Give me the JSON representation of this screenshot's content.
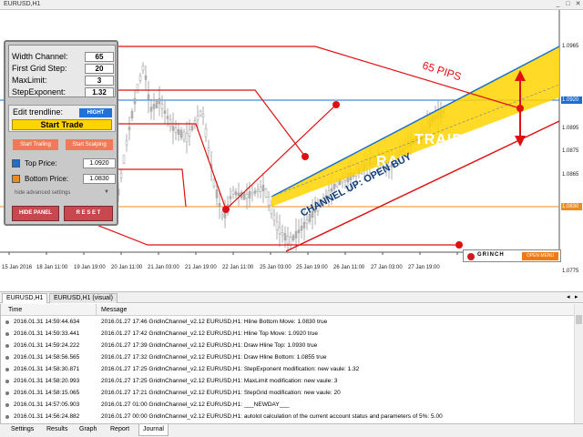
{
  "window": {
    "title": "EURUSD,H1"
  },
  "panel": {
    "width_channel_label": "Width Channel:",
    "width_channel_value": "65",
    "first_grid_label": "First Grid Step:",
    "first_grid_value": "20",
    "maxlimit_label": "MaxLimit:",
    "maxlimit_value": "3",
    "stepexponent_label": "StepExponent:",
    "stepexponent_value": "1.32",
    "edit_trendline_label": "Edit trendline:",
    "hight_button": "HIGHT",
    "start_trade": "Start Trade",
    "start_trailing": "Start Trailing",
    "start_scalping": "Start Scalping",
    "top_price_label": "Top Price:",
    "top_price_value": "1.0920",
    "bottom_price_label": "Bottom Price:",
    "bottom_price_value": "1.0830",
    "hide_advanced": "hide advanced settings",
    "hide_panel": "HIDE PANEL",
    "reset": "R E S E T"
  },
  "annotations": {
    "pips": "65 PIPS",
    "traiding": "TRAIDING",
    "range": "RANGE",
    "channel": "CHANNEL UP: OPEN BUY",
    "grinch": "GRINCH",
    "open_menu": "OPEN MENU"
  },
  "price_axis": [
    "1.0965",
    "1.0920",
    "1.0895",
    "1.0875",
    "1.0865",
    "1.0830",
    "1.0775"
  ],
  "price_axis_highlight": {
    "top": "1.0920",
    "bottom": "1.0830"
  },
  "time_axis": [
    "15 Jan 2016",
    "18 Jan 11:00",
    "19 Jan 19:00",
    "20 Jan 11:00",
    "21 Jan 03:00",
    "21 Jan 19:00",
    "22 Jan 11:00",
    "25 Jan 03:00",
    "25 Jan 19:00",
    "26 Jan 11:00",
    "27 Jan 03:00",
    "27 Jan 19:00"
  ],
  "chart_tabs": [
    "EURUSD,H1",
    "EURUSD,H1 (visual)"
  ],
  "journal": {
    "col_time": "Time",
    "col_message": "Message",
    "rows": [
      {
        "time": "2016.01.31 14:59:44.634",
        "message": "2016.01.27 17:46  GridInChannel_v2.12 EURUSD,H1: Hline Bottom Move: 1.0830  true"
      },
      {
        "time": "2016.01.31 14:59:33.441",
        "message": "2016.01.27 17:42  GridInChannel_v2.12 EURUSD,H1: Hline Top Move: 1.0920  true"
      },
      {
        "time": "2016.01.31 14:59:24.222",
        "message": "2016.01.27 17:39  GridInChannel_v2.12 EURUSD,H1: Draw Hline Top: 1.0930  true"
      },
      {
        "time": "2016.01.31 14:58:56.565",
        "message": "2016.01.27 17:32  GridInChannel_v2.12 EURUSD,H1: Draw Hline Bottom: 1.0855  true"
      },
      {
        "time": "2016.01.31 14:58:30.871",
        "message": "2016.01.27 17:25  GridInChannel_v2.12 EURUSD,H1: StepExponent modification: new vaule: 1.32"
      },
      {
        "time": "2016.01.31 14:58:20.993",
        "message": "2016.01.27 17:25  GridInChannel_v2.12 EURUSD,H1: MaxLimit modification: new vaule: 3"
      },
      {
        "time": "2016.01.31 14:58:15.065",
        "message": "2016.01.27 17:21  GridInChannel_v2.12 EURUSD,H1: StepGrid modification: new vaule: 20"
      },
      {
        "time": "2016.01.31 14:57:05.903",
        "message": "2016.01.27 01:00  GridInChannel_v2.12 EURUSD,H1: ___NEWDAY___"
      },
      {
        "time": "2016.01.31 14:56:24.882",
        "message": "2016.01.27 00:00  GridInChannel_v2.12 EURUSD,H1: autolot calculation of the current account status and parameters of 5%: 5.00"
      }
    ]
  },
  "bottom_tabs": [
    "Settings",
    "Results",
    "Graph",
    "Report",
    "Journal"
  ],
  "colors": {
    "panel_bg": "#c9c9c9",
    "channel_fill": "#ffd400",
    "red": "#e01010",
    "blue_line": "#1a6fd1",
    "orange_line": "#f08a20"
  }
}
